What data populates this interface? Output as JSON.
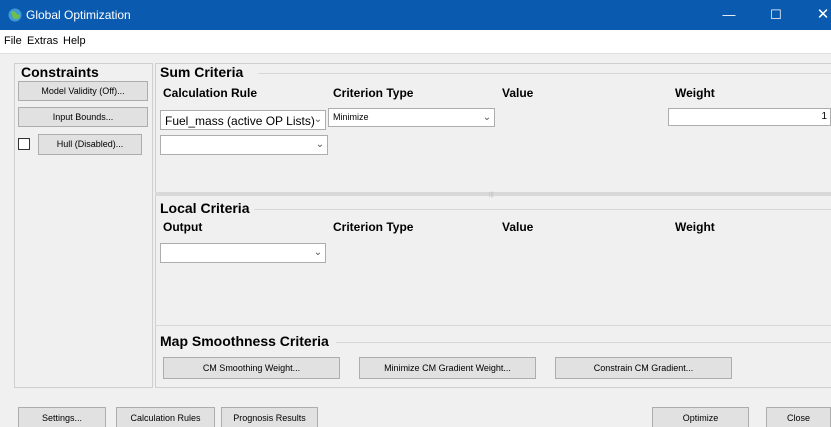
{
  "window": {
    "title": "Global Optimization",
    "minimize_glyph": "—",
    "maximize_glyph": "☐",
    "close_glyph": "✕"
  },
  "menu": [
    "File",
    "Extras",
    "Help"
  ],
  "constraints": {
    "title": "Constraints",
    "model_validity_label": "Model Validity (Off)...",
    "input_bounds_label": "Input Bounds...",
    "hull_label": "Hull (Disabled)...",
    "hull_checked": false
  },
  "sum_criteria": {
    "title": "Sum Criteria",
    "headers": {
      "rule": "Calculation Rule",
      "type": "Criterion Type",
      "value": "Value",
      "weight": "Weight"
    },
    "row1": {
      "rule": "Fuel_mass (active OP Lists)",
      "type": "Minimize",
      "value": "",
      "weight": "1"
    },
    "row2": {
      "rule": ""
    }
  },
  "local_criteria": {
    "title": "Local Criteria",
    "headers": {
      "output": "Output",
      "type": "Criterion Type",
      "value": "Value",
      "weight": "Weight"
    },
    "row1": {
      "output": ""
    }
  },
  "map_smoothness": {
    "title": "Map Smoothness Criteria",
    "cm_smoothing_label": "CM Smoothing Weight...",
    "minimize_gradient_label": "Minimize CM Gradient Weight...",
    "constrain_gradient_label": "Constrain CM Gradient..."
  },
  "footer": {
    "settings_label": "Settings...",
    "calc_rules_label": "Calculation Rules",
    "prognosis_label": "Prognosis Results",
    "optimize_label": "Optimize",
    "close_label": "Close"
  },
  "colors": {
    "titlebar": "#0a5ab0",
    "window_bg": "#f0f0f0",
    "button_bg": "#e1e1e1"
  },
  "icons": {
    "app": "globe-icon",
    "dropdown": "chevron-down-icon"
  }
}
